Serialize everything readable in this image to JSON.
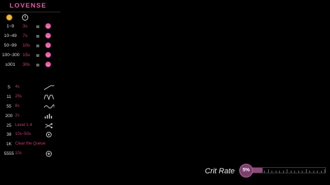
{
  "app": {
    "logo_text": "LOVENSE"
  },
  "header": {
    "coin_icon": "coin-icon",
    "clock_icon": "clock-icon"
  },
  "tip_levels": [
    {
      "level": "1~9",
      "time": "3s",
      "icon": "list-icon",
      "action_icon": "smile-icon"
    },
    {
      "level": "10~49",
      "time": "7s",
      "icon": "list-icon",
      "action_icon": "smile-icon"
    },
    {
      "level": "50~99",
      "time": "10s",
      "icon": "list-icon",
      "action_icon": "smile-icon"
    },
    {
      "level": "100~300",
      "time": "15s",
      "icon": "list-icon",
      "action_icon": "smile-icon"
    },
    {
      "level": "≥301",
      "time": "30s",
      "icon": "list-icon",
      "action_icon": "smile-icon"
    }
  ],
  "special_commands": [
    {
      "level": "5",
      "text": "4s",
      "pattern": "ramp"
    },
    {
      "level": "11",
      "text": "25s",
      "pattern": "pulse"
    },
    {
      "level": "55",
      "text": "8s",
      "pattern": "wave"
    },
    {
      "level": "200",
      "text": "2s",
      "pattern": "bars"
    },
    {
      "level": "25",
      "text": "Level 1-4",
      "pattern": "shuffle"
    },
    {
      "level": "38",
      "text": "10s~50s",
      "pattern": "gear"
    },
    {
      "level": "1K",
      "text": "Clear the Queue",
      "pattern": ""
    },
    {
      "level": "5555",
      "text": "10s",
      "pattern": "plus"
    }
  ],
  "crit": {
    "label": "Crit Rate",
    "value_text": "5%",
    "value": 0.05,
    "knob_color": "#7b3f6d"
  },
  "colors": {
    "accent": "#e75aa6",
    "time_text": "#d43f7c"
  }
}
